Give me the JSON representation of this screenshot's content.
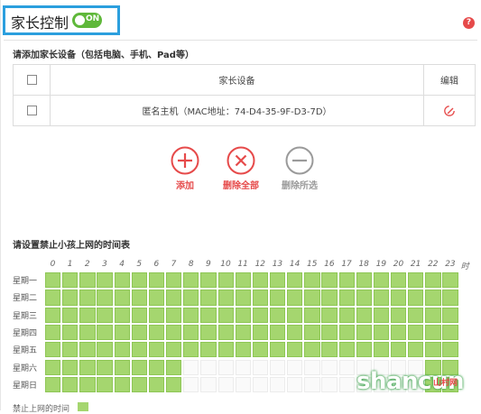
{
  "header": {
    "title": "家长控制",
    "toggle_label": "ON",
    "help_symbol": "?"
  },
  "devices_section": {
    "title": "请添加家长设备（包括电脑、手机、Pad等）",
    "columns": [
      "家长设备",
      "编辑"
    ],
    "rows": [
      {
        "device": "匿名主机（MAC地址：74-D4-35-9F-D3-7D）"
      }
    ]
  },
  "actions": [
    {
      "label": "添加",
      "icon": "plus-icon"
    },
    {
      "label": "删除全部",
      "icon": "close-icon"
    },
    {
      "label": "删除所选",
      "icon": "minus-icon"
    }
  ],
  "schedule": {
    "title": "请设置禁止小孩上网的时间表",
    "hours": [
      "0",
      "1",
      "2",
      "3",
      "4",
      "5",
      "6",
      "7",
      "8",
      "9",
      "10",
      "11",
      "12",
      "13",
      "14",
      "15",
      "16",
      "17",
      "18",
      "19",
      "20",
      "21",
      "22",
      "23"
    ],
    "hour_unit": "时",
    "days": [
      "星期一",
      "星期二",
      "星期三",
      "星期四",
      "星期五",
      "星期六",
      "星期日"
    ],
    "blocked": [
      [
        1,
        1,
        1,
        1,
        1,
        1,
        1,
        1,
        1,
        1,
        1,
        1,
        1,
        1,
        1,
        1,
        1,
        1,
        1,
        1,
        1,
        1,
        1,
        1
      ],
      [
        1,
        1,
        1,
        1,
        1,
        1,
        1,
        1,
        1,
        1,
        1,
        1,
        1,
        1,
        1,
        1,
        1,
        1,
        1,
        1,
        1,
        1,
        1,
        1
      ],
      [
        1,
        1,
        1,
        1,
        1,
        1,
        1,
        1,
        1,
        1,
        1,
        1,
        1,
        1,
        1,
        1,
        1,
        1,
        1,
        1,
        1,
        1,
        1,
        1
      ],
      [
        1,
        1,
        1,
        1,
        1,
        1,
        1,
        1,
        1,
        1,
        1,
        1,
        1,
        1,
        1,
        1,
        1,
        1,
        1,
        1,
        1,
        1,
        1,
        1
      ],
      [
        1,
        1,
        1,
        1,
        1,
        1,
        1,
        1,
        1,
        1,
        1,
        1,
        1,
        1,
        1,
        1,
        1,
        1,
        1,
        1,
        1,
        1,
        1,
        1
      ],
      [
        1,
        1,
        1,
        1,
        1,
        1,
        1,
        1,
        0,
        0,
        0,
        0,
        0,
        0,
        0,
        0,
        0,
        0,
        0,
        0,
        0,
        0,
        1,
        1
      ],
      [
        1,
        1,
        1,
        1,
        1,
        1,
        1,
        1,
        0,
        0,
        0,
        0,
        0,
        0,
        0,
        0,
        0,
        0,
        0,
        0,
        0,
        0,
        1,
        1
      ]
    ],
    "legend_label": "禁止上网的时间"
  },
  "colors": {
    "accent_blue": "#2b9fde",
    "toggle_green": "#5fb83a",
    "action_red": "#e64a4a",
    "action_gray": "#9a9a9a",
    "blocked_cell": "#a5d66f"
  },
  "watermark": {
    "text": "shancun",
    "sub": "山村网"
  }
}
